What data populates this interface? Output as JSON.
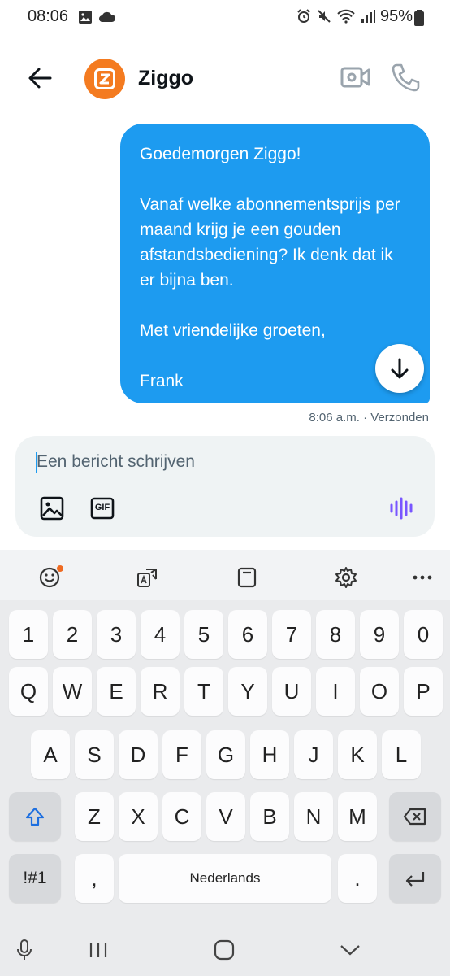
{
  "status_bar": {
    "time": "08:06",
    "battery": "95%"
  },
  "header": {
    "contact_name": "Ziggo"
  },
  "message": {
    "text": "Goedemorgen Ziggo!\n\nVanaf welke abonnementsprijs per maand krijg je een gouden afstandsbediening? Ik denk dat ik er bijna ben.\n\nMet vriendelijke groeten,\n\nFrank",
    "meta": "8:06 a.m. · Verzonden"
  },
  "composer": {
    "placeholder": "Een bericht schrijven",
    "gif_label": "GIF"
  },
  "keyboard": {
    "row_numbers": [
      "1",
      "2",
      "3",
      "4",
      "5",
      "6",
      "7",
      "8",
      "9",
      "0"
    ],
    "row_1": [
      "Q",
      "W",
      "E",
      "R",
      "T",
      "Y",
      "U",
      "I",
      "O",
      "P"
    ],
    "row_2": [
      "A",
      "S",
      "D",
      "F",
      "G",
      "H",
      "J",
      "K",
      "L"
    ],
    "row_3": [
      "Z",
      "X",
      "C",
      "V",
      "B",
      "N",
      "M"
    ],
    "symbols_label": "!#1",
    "comma_label": ",",
    "space_label": "Nederlands",
    "period_label": "."
  },
  "colors": {
    "accent": "#1d9bf0",
    "avatar": "#f47b20",
    "voice": "#7856ff"
  }
}
